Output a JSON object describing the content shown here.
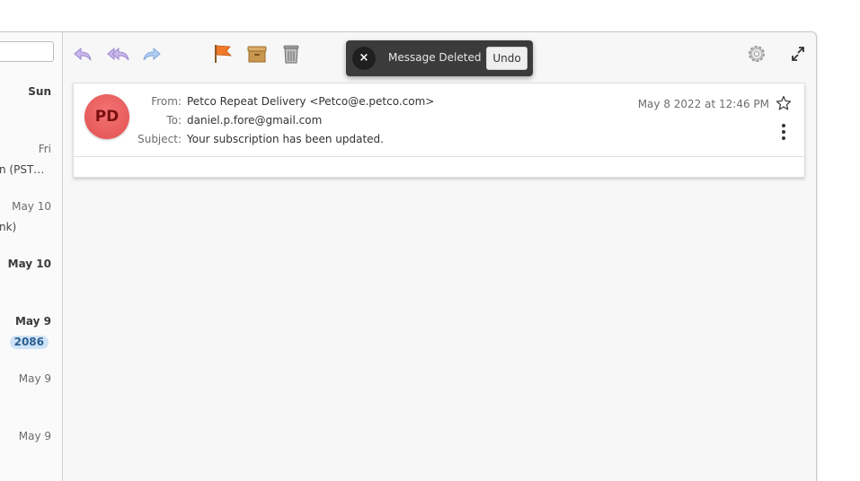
{
  "sidebar": {
    "items": [
      {
        "date": "Sun",
        "bold": true,
        "sub": "",
        "badge": ""
      },
      {
        "date": "Fri",
        "bold": false,
        "sub": "n (PST…",
        "badge": ""
      },
      {
        "date": "May 10",
        "bold": false,
        "sub": "nk)",
        "badge": ""
      },
      {
        "date": "May 10",
        "bold": true,
        "sub": "",
        "badge": ""
      },
      {
        "date": "May  9",
        "bold": true,
        "sub": "",
        "badge": "2086"
      },
      {
        "date": "May  9",
        "bold": false,
        "sub": "",
        "badge": ""
      },
      {
        "date": "May  9",
        "bold": false,
        "sub": "",
        "badge": ""
      }
    ]
  },
  "toolbar": {
    "reply_icon": "reply-icon",
    "reply_all_icon": "reply-all-icon",
    "forward_icon": "forward-icon",
    "flag_icon": "flag-icon",
    "archive_icon": "archive-icon",
    "trash_icon": "trash-icon",
    "settings_icon": "gear-icon",
    "fullscreen_icon": "fullscreen-icon"
  },
  "toast": {
    "message": "Message Deleted",
    "undo_label": "Undo",
    "close_glyph": "×"
  },
  "message": {
    "avatar_initials": "PD",
    "from_label": "From:",
    "from_value": "Petco Repeat Delivery <Petco@e.petco.com>",
    "to_label": "To:",
    "to_value": "daniel.p.fore@gmail.com",
    "subject_label": "Subject:",
    "subject_value": "Your subscription has been updated.",
    "date": "May  8 2022 at 12:46 PM"
  },
  "colors": {
    "avatar": "#e25050",
    "flag": "#f07a2a",
    "archive": "#c8974f",
    "reply": "#b39ddb",
    "forward": "#8fb4e6",
    "badge_bg": "#cfe3f7"
  }
}
